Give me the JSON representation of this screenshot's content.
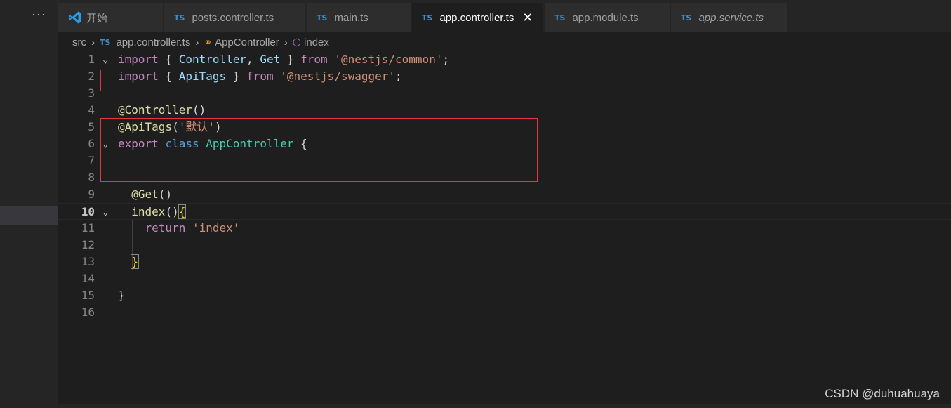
{
  "sidebar": {
    "more_label": "···"
  },
  "tabs": [
    {
      "label": "开始",
      "icon": "vscode-icon",
      "active": false,
      "italic": false
    },
    {
      "badge": "TS",
      "label": "posts.controller.ts",
      "active": false,
      "italic": false
    },
    {
      "badge": "TS",
      "label": "main.ts",
      "active": false,
      "italic": false
    },
    {
      "badge": "TS",
      "label": "app.controller.ts",
      "active": true,
      "italic": false,
      "close": "✕"
    },
    {
      "badge": "TS",
      "label": "app.module.ts",
      "active": false,
      "italic": false
    },
    {
      "badge": "TS",
      "label": "app.service.ts",
      "active": false,
      "italic": true
    }
  ],
  "breadcrumb": {
    "folder": "src",
    "file_badge": "TS",
    "file": "app.controller.ts",
    "class": "AppController",
    "method": "index"
  },
  "editor": {
    "line_numbers": [
      "1",
      "2",
      "3",
      "4",
      "5",
      "6",
      "7",
      "8",
      "9",
      "10",
      "11",
      "12",
      "13",
      "14",
      "15",
      "16"
    ],
    "current_line": "10",
    "lines": {
      "l1": {
        "import": "import",
        "ob": "{",
        "controller": "Controller",
        "comma": ",",
        "get": "Get",
        "cb": "}",
        "from": "from",
        "module": "'@nestjs/common'",
        "semi": ";"
      },
      "l2": {
        "import": "import",
        "ob": "{",
        "apitags": "ApiTags",
        "cb": "}",
        "from": "from",
        "module": "'@nestjs/swagger'",
        "semi": ";"
      },
      "l4": {
        "at": "@",
        "dec": "Controller",
        "parens": "()"
      },
      "l5": {
        "at": "@",
        "dec": "ApiTags",
        "op": "(",
        "arg": "'默认'",
        "cp": ")"
      },
      "l6": {
        "export": "export",
        "class": "class",
        "name": "AppController",
        "ob": "{"
      },
      "l9": {
        "at": "@",
        "dec": "Get",
        "parens": "()"
      },
      "l10": {
        "method": "index",
        "parens": "()",
        "ob": "{"
      },
      "l11": {
        "return": "return",
        "value": "'index'"
      },
      "l13": {
        "cb": "}"
      },
      "l15": {
        "cb": "}"
      }
    }
  },
  "watermark": "CSDN @duhuahuaya",
  "colors": {
    "background": "#1e1e1e",
    "highlight_box": "#e0383e",
    "ts_badge": "#3d8fd1"
  }
}
